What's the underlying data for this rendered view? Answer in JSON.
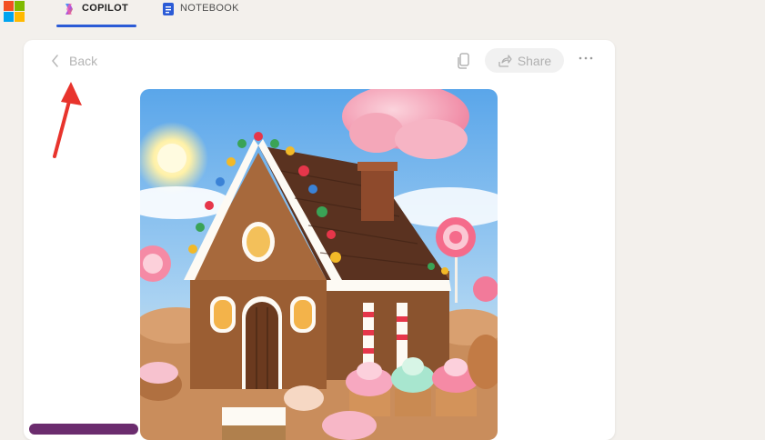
{
  "tabs": [
    {
      "label": "COPILOT",
      "active": true,
      "icon": "copilot-icon"
    },
    {
      "label": "NOTEBOOK",
      "active": false,
      "icon": "notebook-icon"
    }
  ],
  "toolbar": {
    "back_label": "Back",
    "share_label": "Share",
    "copy_icon": "copy-icon",
    "more_icon": "more-icon"
  },
  "image": {
    "subject": "gingerbread-house"
  },
  "colors": {
    "accent": "#2b5bd6",
    "arrow": "#e8342d"
  }
}
